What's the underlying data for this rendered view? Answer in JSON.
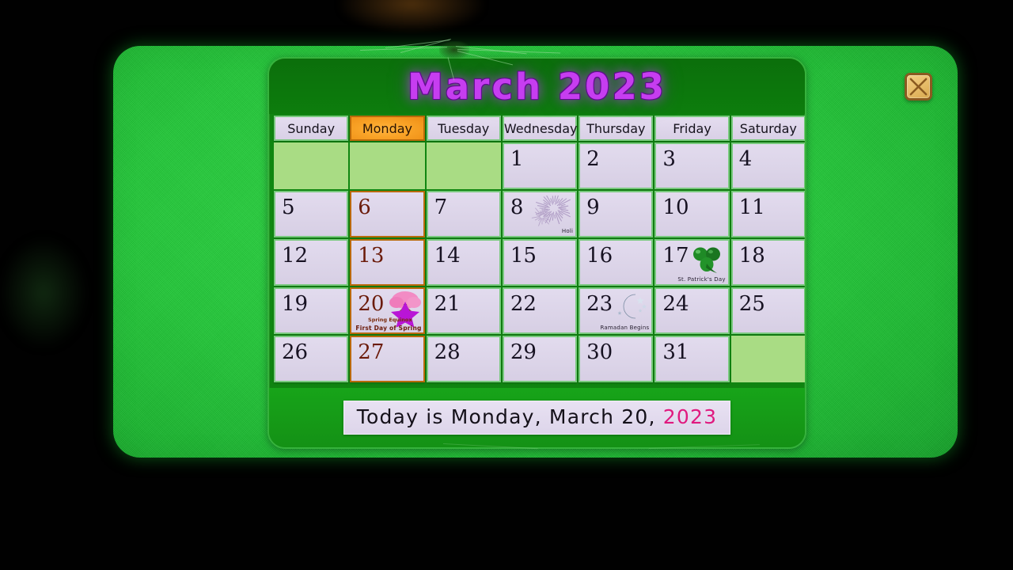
{
  "app": {
    "title": "March 2023",
    "close_icon": "close-x-icon"
  },
  "calendar": {
    "month": "March",
    "year": "2023",
    "day_headers": [
      "Sunday",
      "Monday",
      "Tuesday",
      "Wednesday",
      "Thursday",
      "Friday",
      "Saturday"
    ],
    "highlighted_day_name": "Monday",
    "today_day_number": "20",
    "weeks": [
      [
        {
          "num": "",
          "empty": true
        },
        {
          "num": "",
          "empty": true
        },
        {
          "num": "",
          "empty": true
        },
        {
          "num": "1"
        },
        {
          "num": "2"
        },
        {
          "num": "3"
        },
        {
          "num": "4"
        }
      ],
      [
        {
          "num": "5"
        },
        {
          "num": "6",
          "today_col": true
        },
        {
          "num": "7"
        },
        {
          "num": "8",
          "holiday": "Holi",
          "icon": "firework-icon"
        },
        {
          "num": "9"
        },
        {
          "num": "10"
        },
        {
          "num": "11"
        }
      ],
      [
        {
          "num": "12"
        },
        {
          "num": "13",
          "today_col": true
        },
        {
          "num": "14"
        },
        {
          "num": "15"
        },
        {
          "num": "16"
        },
        {
          "num": "17",
          "holiday": "St. Patrick's Day",
          "icon": "shamrock-icon"
        },
        {
          "num": "18"
        }
      ],
      [
        {
          "num": "19"
        },
        {
          "num": "20",
          "today_col": true,
          "holiday": "First Day of Spring",
          "holiday_sub": "Spring Equinox",
          "icon": "spring-tree-star-icon"
        },
        {
          "num": "21"
        },
        {
          "num": "22"
        },
        {
          "num": "23",
          "holiday": "Ramadan Begins",
          "icon": "crescent-moon-icon"
        },
        {
          "num": "24"
        },
        {
          "num": "25"
        }
      ],
      [
        {
          "num": "26"
        },
        {
          "num": "27",
          "today_col": true
        },
        {
          "num": "28"
        },
        {
          "num": "29"
        },
        {
          "num": "30"
        },
        {
          "num": "31"
        },
        {
          "num": "",
          "empty": true
        }
      ]
    ]
  },
  "footer": {
    "today_prefix": "Today is Monday, March 20, ",
    "today_year": "2023"
  },
  "colors": {
    "panel_green": "#24c93a",
    "window_green": "#118a12",
    "title_purple": "#c63df0",
    "highlight_orange": "#f9a52c",
    "cell_lavender": "#ded6eb",
    "cell_border_green": "#79c97e",
    "empty_cell_green": "#a9dc84",
    "year_pink": "#e0197f"
  }
}
